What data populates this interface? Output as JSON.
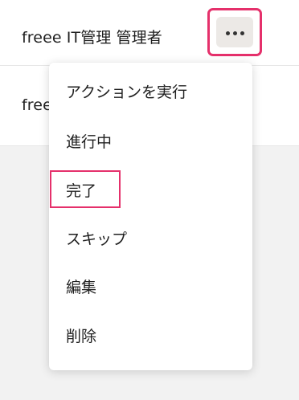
{
  "rows": [
    {
      "label": "freee IT管理 管理者"
    },
    {
      "label": "freee IT管理 管理者"
    }
  ],
  "more_button": {
    "icon": "more-horizontal-icon",
    "highlight_color": "#e5306b"
  },
  "menu": {
    "items": [
      {
        "label": "アクションを実行"
      },
      {
        "label": "進行中"
      },
      {
        "label": "完了"
      },
      {
        "label": "スキップ"
      },
      {
        "label": "編集"
      },
      {
        "label": "削除"
      }
    ],
    "highlighted_item": "完了"
  }
}
